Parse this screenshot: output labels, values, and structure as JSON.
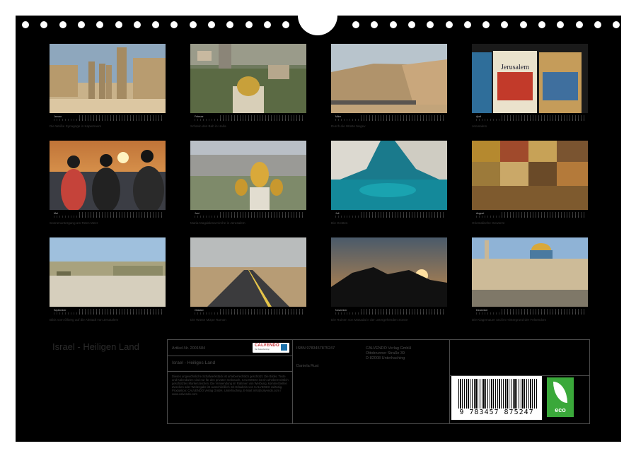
{
  "calendar": {
    "title": "Israel - Heiligen Land",
    "months": [
      {
        "month": "Januar",
        "caption": "Die Weiße Synagoge in Kapernaum"
      },
      {
        "month": "Februar",
        "caption": "Schrein des Bab in Haifa"
      },
      {
        "month": "März",
        "caption": "Durch die Wüste Negev"
      },
      {
        "month": "April",
        "caption": "Jerusalem",
        "jar_label": "Jerusalem"
      },
      {
        "month": "Mai",
        "caption": "Sonnenuntergang am Toten Meer"
      },
      {
        "month": "Juni",
        "caption": "Maria-Magdalena-Kirche in Jerusalem"
      },
      {
        "month": "Juli",
        "caption": "Die Grotten"
      },
      {
        "month": "August",
        "caption": "Orientalische Gewürze"
      },
      {
        "month": "September",
        "caption": "Blick vom Ölberg auf die Altstadt von Jerusalem"
      },
      {
        "month": "Oktober",
        "caption": "Die Wüste Mizpe Ramon"
      },
      {
        "month": "November",
        "caption": "Die Ruinen von Masada in der untergehenden Sonne"
      },
      {
        "month": "Dezember",
        "caption": "Die Klagemauer und im Hintergrund der Felsendom"
      }
    ]
  },
  "info": {
    "article": "Artikel-Nr. 2001584",
    "subtitle": "Israel - Heiliges Land",
    "logo_name": "CALVENDO",
    "logo_tagline": "Der Kalendershop",
    "isbn": "ISBN 9783457875247",
    "publisher": [
      "CALVENDO Verlag GmbH",
      "Ottobrunner Straße 39",
      "D-82008 Unterhaching"
    ],
    "photographer": "Daniela Rust",
    "body": "Dieses ungewöhnliche Schafwerkstück ist urheberrechtlich geschützt. Die Bilder, Texte und Kalendarien sind nur für den privaten Gebrauch. CALVENDO ist ein urheberrechtlich geschütztes Markenzeichen. Die Verwendung im Rahmen von Werbung, kommerziellen Zwecken oder Weitergabe ist ausschließlich mit Erlaubnis von CALVENDO zulässig. Produktion: CALVENDO Verlag GmbH, Unterhaching. E-Mail: info@calvendo.com / www.calvendo.com",
    "barcode_number": "9 783457 875247",
    "eco_label": "eco"
  }
}
